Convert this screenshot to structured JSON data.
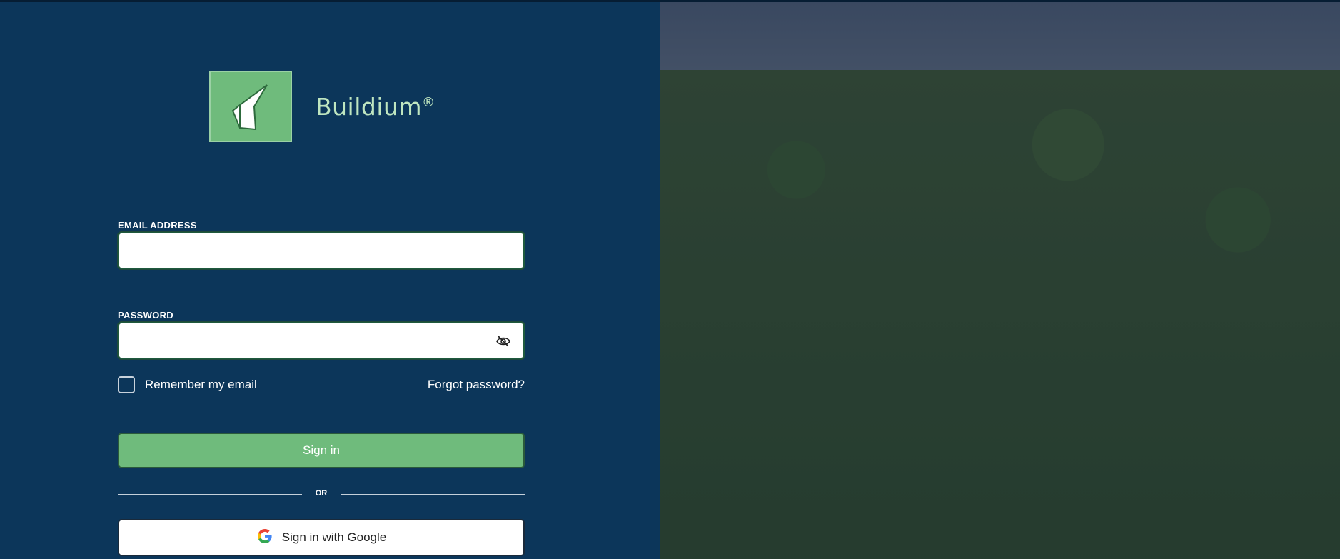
{
  "brand": {
    "name": "Buildium",
    "mark": "®"
  },
  "form": {
    "email_label": "EMAIL ADDRESS",
    "email_value": "",
    "password_label": "PASSWORD",
    "password_value": "",
    "remember_label": "Remember my email",
    "forgot_label": "Forgot password?",
    "signin_label": "Sign in",
    "or_label": "OR",
    "google_label": "Sign in with Google"
  },
  "icons": {
    "password_toggle": "eye-slash-icon",
    "google": "google-g-icon"
  },
  "colors": {
    "panel_bg": "#0c365a",
    "accent_green": "#6fbb7c",
    "logo_text": "#bfe6c0"
  }
}
